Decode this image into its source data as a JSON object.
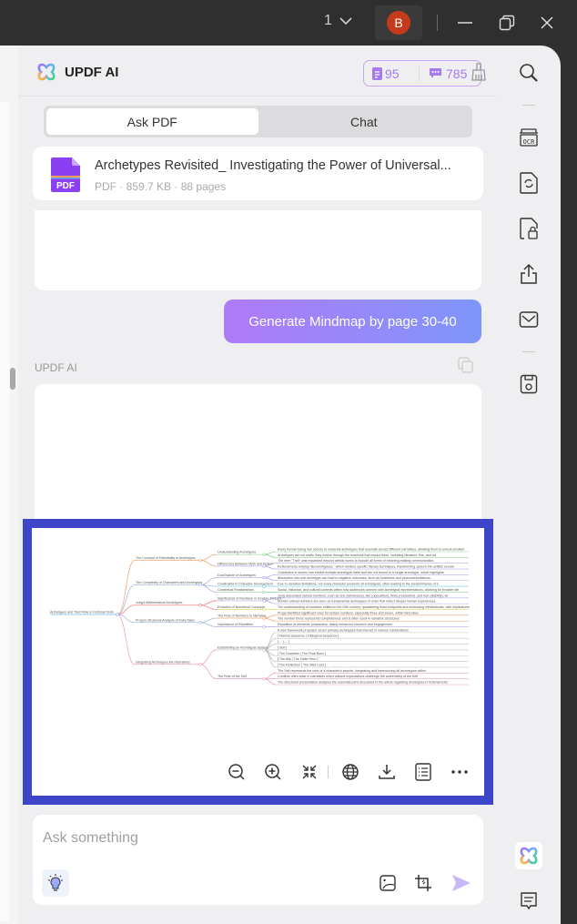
{
  "titlebar": {
    "page_indicator": "1",
    "avatar_initial": "B"
  },
  "header": {
    "brand": "UPDF AI",
    "quota_pdf": "95",
    "quota_chat": "785"
  },
  "tabs": [
    {
      "label": "Ask PDF",
      "active": true
    },
    {
      "label": "Chat",
      "active": false
    }
  ],
  "file": {
    "title": "Archetypes Revisited_ Investigating the Power of Universal...",
    "type_label": "PDF",
    "meta": "PDF · 859.7 KB · 88 pages"
  },
  "conversation": {
    "user_message": "Generate Mindmap by page 30-40",
    "ai_label": "UPDF AI"
  },
  "mindmap": {
    "root": "Archetypes and Their Role in Fictional Texts",
    "branches": [
      {
        "label": "The Concept of Potentiality in Archetypes",
        "color": "#f0a878",
        "children": [
          {
            "label": "Understanding Archetypes",
            "color": "#8fd39b",
            "leaves": [
              "Every human being has access to universal archetypes that resonate across different narratives, allowing them to unlock emotion",
              "Archetypes are not static; they evolve through the emotions that impact them, including literature, film, and art."
            ]
          },
          {
            "label": "Differences Between Myth and Fiction",
            "color": "#b9a6e6",
            "leaves": [
              "The term \"Trait\" was expanded beyond artistic works to include all forms of meaning-making communication.",
              "Fictional texts employ \"Becomingness,\" which renders specific literary techniques, transforming speech into artistic overall"
            ]
          }
        ]
      },
      {
        "label": "The Complexity of Characters and Archetypes",
        "color": "#a9b6e4",
        "children": [
          {
            "label": "Dual Nature of Archetypes",
            "color": "#b9a6e6",
            "leaves": [
              "Characters in stories can exhibit multiple archetypal traits and are not bound to a single archetype, which highlights",
              "Absorption into one archetype can lead to negative outcomes, such as loneliness and personal limitations."
            ]
          },
          {
            "label": "Constraints in Character Development",
            "color": "#7cc8e0",
            "leaves": [
              "Due to narrative limitations, not every character presents all archetypes, often leading to the predominance of a"
            ]
          },
          {
            "label": "Contextual Relationships",
            "color": "#8fd39b",
            "leaves": [
              "Social, historical, and cultural contexts affect how audiences connect with archetypal representations, allowing for broader ide"
            ]
          }
        ]
      },
      {
        "label": "Jung's Mathematical Archetypes",
        "color": "#f08a8a",
        "children": [
          {
            "label": "Significance of Numbers in Jungian Thought",
            "color": "#b9a6e6",
            "leaves": [
              "Jung associated natural numbers, such as one (wholeness), two (opposition), three (resolution), and four (stability), wi",
              "Similar cultural numbers are seen as fundamental archetypes of order that reflect deeper human experiences."
            ]
          },
          {
            "label": "Evolution of Numerical Concepts",
            "color": "#e6d36e",
            "leaves": [
              "The understanding of numbers shifted in the 20th century, questioning fixed endpoints and embracing infinitesimals, with implications"
            ]
          }
        ]
      },
      {
        "label": "Propp's Structural Analysis of Fairy Tales",
        "color": "#a9b6e4",
        "children": [
          {
            "label": "The Role of Numbers in Narrative",
            "color": "#f0a878",
            "leaves": [
              "Propp identified significant roles for certain numbers, especially three and seven, within fairy tales",
              "The number three represents completeness and is often used in narrative structures"
            ]
          },
          {
            "label": "Importance of Repetition",
            "color": "#b9a6e6",
            "leaves": [
              "Repetition of elements (characters, tasks) enhances structure and engagement"
            ]
          }
        ]
      },
      {
        "label": "Integrating Archetypes into Narratives",
        "color": "#f0a0b8",
        "children": [
          {
            "label": "Establishing an Archetypal System",
            "color": "#c0c0c0",
            "leaves": [
              "A new framework proposes seven primary archetypes that interact in various combinations",
              "[ Natural sequence | Dialogical sequence ]",
              "[ ... | ... ]",
              "[ Self ]",
              "[ The Guardian | The Final Boss ]",
              "[ The Ally | The False Hero ]",
              "[ The Reflection | The Wild Card ]"
            ]
          },
          {
            "label": "The Role of the Self",
            "color": "#f0a0b8",
            "leaves": [
              "The Self represents the core of a character's psyche, integrating and harmonizing all archetypes within",
              "Conflicts often arise in narratives when cultural expectations challenge the authenticity of the Self",
              "The structured presentation analyzes the essential parts discussed in the article regarding archetypes in fictional texts"
            ]
          }
        ]
      }
    ]
  },
  "mindmap_toolbar": [
    "zoom-out",
    "zoom-in",
    "collapse",
    "language",
    "download",
    "outline",
    "more"
  ],
  "input": {
    "placeholder": "Ask something",
    "value": ""
  },
  "colors": {
    "accent": "#a57bf0",
    "highlight_frame": "#3d45c9",
    "gradient_start": "#b07af8",
    "gradient_end": "#7e96fb",
    "avatar": "#c43a1a"
  }
}
